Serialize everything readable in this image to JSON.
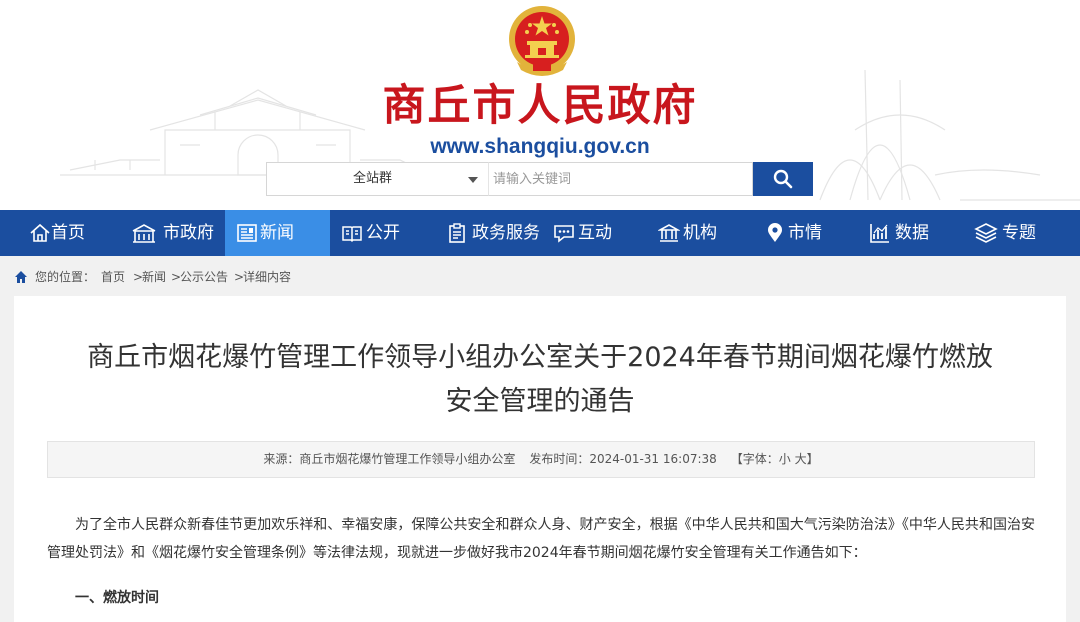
{
  "header": {
    "title": "商丘市人民政府",
    "url": "www.shangqiu.gov.cn",
    "emblem_icon": "national-emblem-icon",
    "search": {
      "scope": "全站群",
      "placeholder": "请输入关键词"
    }
  },
  "nav": {
    "items": [
      {
        "label": "首页",
        "icon": "home-icon"
      },
      {
        "label": "市政府",
        "icon": "building-icon"
      },
      {
        "label": "新闻",
        "icon": "news-icon"
      },
      {
        "label": "公开",
        "icon": "book-icon"
      },
      {
        "label": "政务服务",
        "icon": "clipboard-icon"
      },
      {
        "label": "互动",
        "icon": "chat-icon"
      },
      {
        "label": "机构",
        "icon": "institution-icon"
      },
      {
        "label": "市情",
        "icon": "location-pin-icon"
      },
      {
        "label": "数据",
        "icon": "chart-icon"
      },
      {
        "label": "专题",
        "icon": "layers-icon"
      }
    ],
    "active": "新闻"
  },
  "breadcrumb": {
    "prefix": "您的位置：",
    "items": [
      "首页",
      "新闻",
      "公示公告",
      "详细内容"
    ],
    "separator": ">"
  },
  "article": {
    "title": "商丘市烟花爆竹管理工作领导小组办公室关于2024年春节期间烟花爆竹燃放安全管理的通告",
    "meta": {
      "source": "来源：商丘市烟花爆竹管理工作领导小组办公室",
      "time": "发布时间：2024-01-31 16:07:38",
      "font_open": "【字体：",
      "font_small": "小",
      "font_large": "大",
      "font_close": "】"
    },
    "paragraph": "为了全市人民群众新春佳节更加欢乐祥和、幸福安康，保障公共安全和群众人身、财产安全，根据《中华人民共和国大气污染防治法》《中华人民共和国治安管理处罚法》和《烟花爆竹安全管理条例》等法律法规，现就进一步做好我市2024年春节期间烟花爆竹安全管理有关工作通告如下：",
    "section1": "一、燃放时间"
  },
  "colors": {
    "brand_red": "#c8161d",
    "brand_blue": "#1b4e9f",
    "nav_active": "#3a8ee6"
  }
}
